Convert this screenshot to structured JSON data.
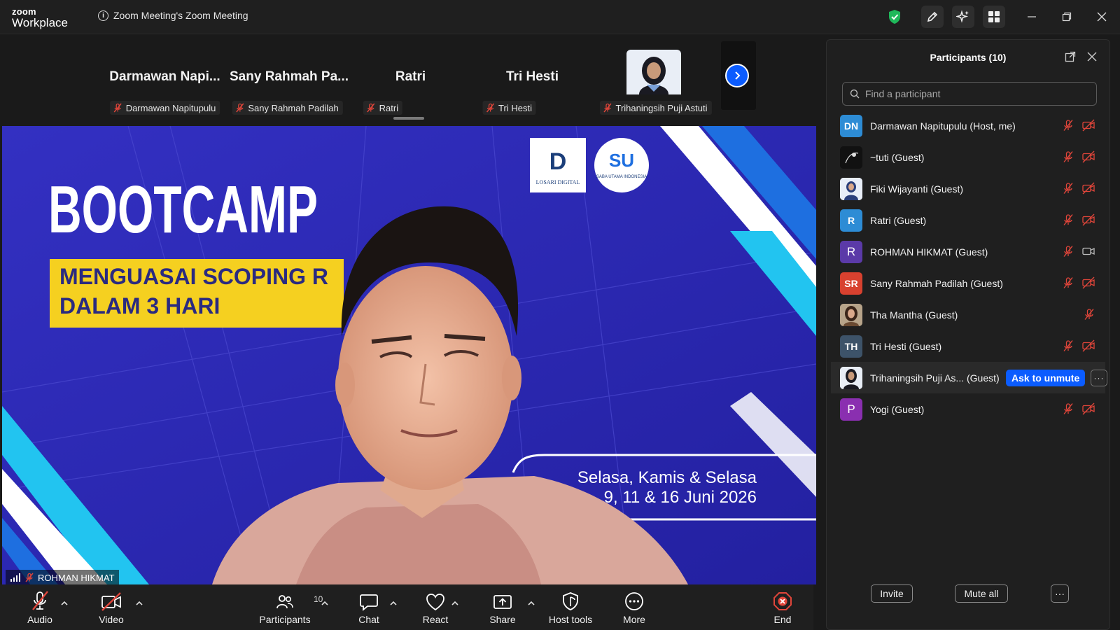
{
  "app": {
    "brand_top": "zoom",
    "brand_bottom": "Workplace",
    "meeting_title": "Zoom Meeting's Zoom Meeting"
  },
  "strip": {
    "tiles": [
      {
        "name": "Darmawan  Napi...",
        "tag": "Darmawan Napitupulu"
      },
      {
        "name": "Sany Rahmah Pa...",
        "tag": "Sany Rahmah Padilah"
      },
      {
        "name": "Ratri",
        "tag": "Ratri"
      },
      {
        "name": "Tri Hesti",
        "tag": "Tri Hesti"
      },
      {
        "name": "",
        "tag": "Trihaningsih Puji Astuti"
      }
    ]
  },
  "video": {
    "speaker_label": "ROHMAN HIKMAT",
    "banner_title": "BOOTCAMP",
    "banner_line1": "MENGUASAI SCOPING R",
    "banner_line2": "DALAM 3 HARI",
    "date_line1": "Selasa, Kamis & Selasa",
    "date_line2": "9, 11 & 16 Juni 2026",
    "logo1_text": "LOSARI DIGITAL",
    "logo2_text": "SABA UTAMA INDONESIA",
    "colors": {
      "banner_bg": "#2b28b0",
      "highlight": "#f5d020",
      "cyan": "#22c4f0"
    }
  },
  "toolbar": {
    "audio": "Audio",
    "video": "Video",
    "participants": "Participants",
    "participants_count": "10",
    "chat": "Chat",
    "react": "React",
    "share": "Share",
    "host_tools": "Host tools",
    "more": "More",
    "end": "End"
  },
  "panel": {
    "title": "Participants (10)",
    "search_placeholder": "Find a participant",
    "participants": [
      {
        "initials": "DN",
        "name": "Darmawan Napitupulu (Host, me)",
        "color": "#2d8cd5"
      },
      {
        "initials": "",
        "name": "~tuti (Guest)",
        "color": "#111111"
      },
      {
        "initials": "",
        "name": "Fiki Wijayanti (Guest)",
        "color": "#6a87b8"
      },
      {
        "initials": "R",
        "name": "Ratri (Guest)",
        "color": "#2d8cd5"
      },
      {
        "initials": "R",
        "name": "ROHMAN HIKMAT (Guest)",
        "color": "#5b3aa8"
      },
      {
        "initials": "SR",
        "name": "Sany Rahmah Padilah (Guest)",
        "color": "#d8412f"
      },
      {
        "initials": "",
        "name": "Tha Mantha (Guest)",
        "color": "#8a6a4a"
      },
      {
        "initials": "TH",
        "name": "Tri Hesti (Guest)",
        "color": "#3d5369"
      },
      {
        "initials": "",
        "name": "Trihaningsih Puji As...  (Guest)",
        "color": "#e9eef6"
      },
      {
        "initials": "P",
        "name": "Yogi (Guest)",
        "color": "#8a2fb0"
      }
    ],
    "ask_to_unmute": "Ask to unmute",
    "invite": "Invite",
    "mute_all": "Mute all",
    "more_dots": "···"
  }
}
